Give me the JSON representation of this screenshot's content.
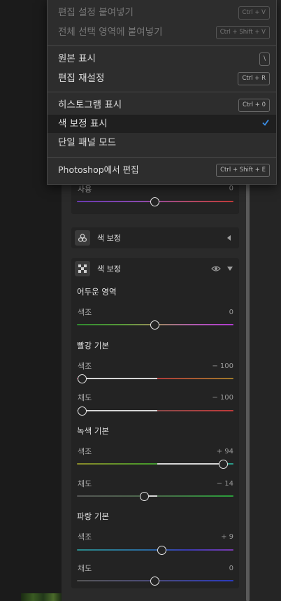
{
  "menu": {
    "items": [
      {
        "label": "편집 설정 붙여넣기",
        "shortcut": "Ctrl + V",
        "disabled": true
      },
      {
        "label": "전체 선택 영역에 붙여넣기",
        "shortcut": "Ctrl + Shift + V",
        "disabled": true
      },
      {
        "label": "원본 표시",
        "shortcut": "\\"
      },
      {
        "label": "편집 재설정",
        "shortcut": "Ctrl + R"
      },
      {
        "label": "히스토그램 표시",
        "shortcut": "Ctrl + 0"
      },
      {
        "label": "색 보정 표시",
        "checked": true
      },
      {
        "label": "단일 패널 모드"
      },
      {
        "label": "Photoshop에서 편집",
        "shortcut": "Ctrl + Shift + E"
      }
    ]
  },
  "upper_section": {
    "partial_label": "사용",
    "partial_value": "0",
    "partial_level": 0.5
  },
  "color_adjust_collapsed": {
    "title": "색 보정"
  },
  "color_adjust": {
    "title": "색 보정",
    "shadows": {
      "heading": "어두운 영역",
      "hue_label": "색조",
      "hue_value": "0",
      "hue_level": 0.5
    },
    "red": {
      "heading": "빨강 기본",
      "hue_label": "색조",
      "hue_value": "− 100",
      "hue_level": 0.0,
      "sat_label": "채도",
      "sat_value": "− 100",
      "sat_level": 0.0
    },
    "green": {
      "heading": "녹색 기본",
      "hue_label": "색조",
      "hue_value": "+ 94",
      "hue_level": 0.97,
      "sat_label": "채도",
      "sat_value": "− 14",
      "sat_level": 0.43
    },
    "blue": {
      "heading": "파랑 기본",
      "hue_label": "색조",
      "hue_value": "+ 9",
      "hue_level": 0.55,
      "sat_label": "채도",
      "sat_value": "0",
      "sat_level": 0.5
    }
  },
  "colors": {
    "accent": "#3b8ee6",
    "menu_bg": "#2d2d2d",
    "panel_bg": "#2a2a2a"
  }
}
